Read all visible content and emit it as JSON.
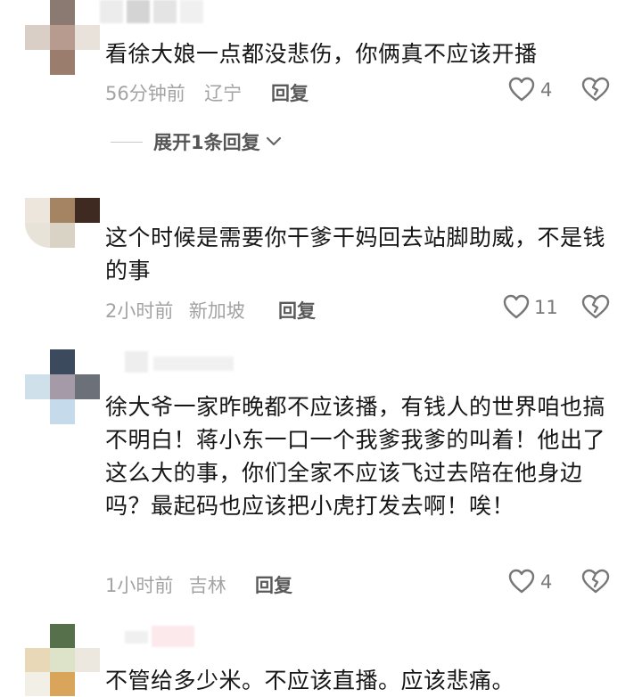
{
  "comments": [
    {
      "text": "看徐大娘一点都没悲伤，你俩真不应该开播",
      "time": "56分钟前",
      "location": "辽宁",
      "reply_label": "回复",
      "likes": "4",
      "expand_label": "展开1条回复"
    },
    {
      "text": "这个时候是需要你干爹干妈回去站脚助威，不是钱的事",
      "time": "2小时前",
      "location": "新加坡",
      "reply_label": "回复",
      "likes": "11"
    },
    {
      "text": "徐大爷一家昨晚都不应该播，有钱人的世界咱也搞不明白！蒋小东一口一个我爹我爹的叫着！他出了这么大的事，你们全家不应该飞过去陪在他身边吗？最起码也应该把小虎打发去啊！唉！",
      "time": "1小时前",
      "location": "吉林",
      "reply_label": "回复",
      "likes": "4"
    },
    {
      "text": "不管给多少米。不应该直播。应该悲痛。"
    }
  ],
  "icons": {
    "like": "heart-outline-icon",
    "dislike": "broken-heart-icon",
    "expand": "chevron-down-icon"
  },
  "colors": {
    "text": "#161616",
    "meta": "#a3a3a3",
    "reply": "#5a5a5a"
  }
}
